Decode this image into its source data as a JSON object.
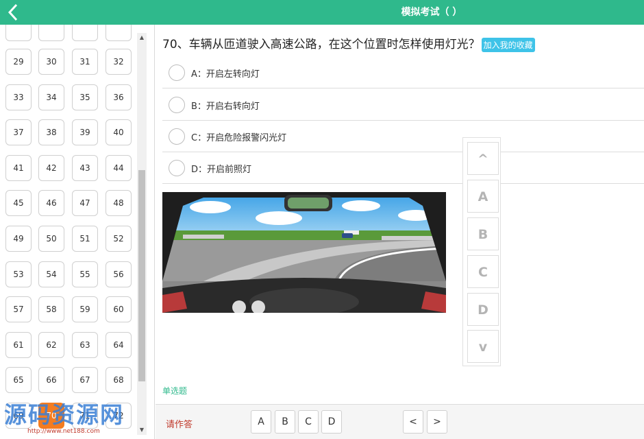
{
  "header": {
    "title": "模拟考试（ ）"
  },
  "question_grid": {
    "numbers": [
      "29",
      "30",
      "31",
      "32",
      "33",
      "34",
      "35",
      "36",
      "37",
      "38",
      "39",
      "40",
      "41",
      "42",
      "43",
      "44",
      "45",
      "46",
      "47",
      "48",
      "49",
      "50",
      "51",
      "52",
      "53",
      "54",
      "55",
      "56",
      "57",
      "58",
      "59",
      "60",
      "61",
      "62",
      "63",
      "64",
      "65",
      "66",
      "67",
      "68",
      "69",
      "70",
      "71",
      "72"
    ],
    "active": "70"
  },
  "question": {
    "text": "70、车辆从匝道驶入高速公路，在这个位置时怎样使用灯光？",
    "favorite_label": "加入我的收藏",
    "type_label": "单选题"
  },
  "options": [
    {
      "label": "A：开启左转向灯"
    },
    {
      "label": "B：开启右转向灯"
    },
    {
      "label": "C：开启危险报警闪光灯"
    },
    {
      "label": "D：开启前照灯"
    }
  ],
  "side_nav": {
    "keys": [
      "^",
      "A",
      "B",
      "C",
      "D",
      "v"
    ]
  },
  "bottom": {
    "prompt": "请作答",
    "answers": [
      "A",
      "B",
      "C",
      "D"
    ],
    "prev": "<",
    "next": ">"
  },
  "watermark": {
    "text": "源码资源网",
    "url": "http://www.net188.com"
  },
  "colors": {
    "header": "#2fb98c",
    "active_number": "#f47c20",
    "favorite": "#3ec3e8"
  }
}
